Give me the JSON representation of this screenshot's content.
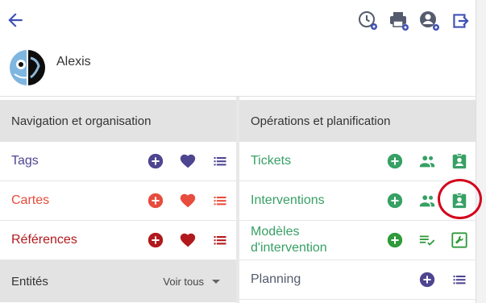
{
  "user": {
    "name": "Alexis"
  },
  "sections": {
    "nav": {
      "title": "Navigation et organisation",
      "items": [
        {
          "label": "Tags",
          "color": "#4e4591"
        },
        {
          "label": "Cartes",
          "color": "#e74c3c"
        },
        {
          "label": "Références",
          "color": "#b2191c"
        }
      ]
    },
    "ops": {
      "title": "Opérations et planification",
      "items": [
        {
          "label": "Tickets",
          "color": "#37a065"
        },
        {
          "label": "Interventions",
          "color": "#37a065"
        },
        {
          "label": "Modèles d'intervention",
          "label_line1": "Modèles",
          "label_line2": "d'intervention",
          "color": "#37a065"
        },
        {
          "label": "Planning",
          "color": "#555b6e"
        }
      ]
    },
    "entites": {
      "title": "Entités",
      "filter_label": "Voir tous"
    }
  },
  "icons": {
    "topbar": [
      "back-arrow-icon",
      "history-settings-icon",
      "print-settings-icon",
      "account-settings-icon",
      "logout-icon"
    ],
    "row_actions": [
      "add-circle-icon",
      "heart-icon",
      "list-icon",
      "group-icon",
      "assignment-ind-icon",
      "playlist-check-icon",
      "wrench-icon"
    ]
  },
  "colors": {
    "purple": "#4e4591",
    "red": "#e74c3c",
    "darkred": "#b2191c",
    "green": "#37a065",
    "slate": "#555b6e",
    "topbar_icons": "#555b6e",
    "back_arrow": "#3f51b5",
    "highlight": "#d4001a"
  }
}
